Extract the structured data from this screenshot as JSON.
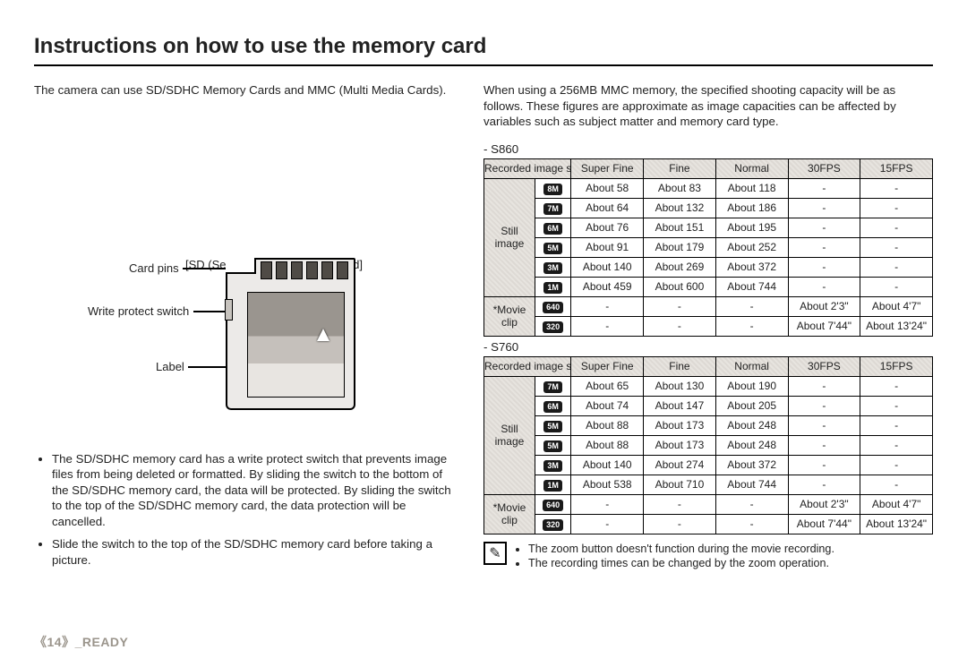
{
  "title": "Instructions on how to use the memory card",
  "left": {
    "intro": "The camera can use SD/SDHC Memory Cards and MMC (Multi Media Cards).",
    "callouts": {
      "pins": "Card pins",
      "wps": "Write protect switch",
      "label": "Label"
    },
    "sdcaption": "[SD (Secure Digital) memory card]",
    "bullets": [
      "The SD/SDHC memory card has a write protect switch that prevents image files from being deleted or formatted. By sliding the switch to the bottom of the SD/SDHC memory card, the data will be protected. By sliding the switch to the top of the SD/SDHC memory card, the data protection will be cancelled.",
      "Slide the switch to the top of the SD/SDHC memory card before taking a picture."
    ]
  },
  "right": {
    "intro": "When using a 256MB MMC memory, the specified shooting capacity will be as follows. These figures are approximate as image capacities can be affected by variables such as subject matter and memory card type.",
    "models": [
      "- S860",
      "- S760"
    ],
    "headers": {
      "ri": "Recorded image size",
      "sf": "Super Fine",
      "f": "Fine",
      "n": "Normal",
      "f30": "30FPS",
      "f15": "15FPS"
    },
    "groups": {
      "still": "Still image",
      "movie": "*Movie clip"
    },
    "tables": [
      {
        "still": [
          {
            "ic": "8M",
            "sf": "About 58",
            "f": "About 83",
            "n": "About 118",
            "a": "-",
            "b": "-"
          },
          {
            "ic": "7M",
            "sf": "About 64",
            "f": "About 132",
            "n": "About 186",
            "a": "-",
            "b": "-"
          },
          {
            "ic": "6M",
            "sf": "About 76",
            "f": "About 151",
            "n": "About 195",
            "a": "-",
            "b": "-"
          },
          {
            "ic": "5M",
            "sf": "About 91",
            "f": "About 179",
            "n": "About 252",
            "a": "-",
            "b": "-"
          },
          {
            "ic": "3M",
            "sf": "About 140",
            "f": "About 269",
            "n": "About 372",
            "a": "-",
            "b": "-"
          },
          {
            "ic": "1M",
            "sf": "About 459",
            "f": "About 600",
            "n": "About 744",
            "a": "-",
            "b": "-"
          }
        ],
        "movie": [
          {
            "ic": "640",
            "sf": "-",
            "f": "-",
            "n": "-",
            "a": "About 2'3\"",
            "b": "About 4'7\""
          },
          {
            "ic": "320",
            "sf": "-",
            "f": "-",
            "n": "-",
            "a": "About 7'44\"",
            "b": "About 13'24\""
          }
        ]
      },
      {
        "still": [
          {
            "ic": "7M",
            "sf": "About 65",
            "f": "About 130",
            "n": "About 190",
            "a": "-",
            "b": "-"
          },
          {
            "ic": "6M",
            "sf": "About 74",
            "f": "About 147",
            "n": "About 205",
            "a": "-",
            "b": "-"
          },
          {
            "ic": "5M",
            "sf": "About 88",
            "f": "About 173",
            "n": "About 248",
            "a": "-",
            "b": "-"
          },
          {
            "ic": "5M",
            "sf": "About 88",
            "f": "About 173",
            "n": "About 248",
            "a": "-",
            "b": "-"
          },
          {
            "ic": "3M",
            "sf": "About 140",
            "f": "About 274",
            "n": "About 372",
            "a": "-",
            "b": "-"
          },
          {
            "ic": "1M",
            "sf": "About 538",
            "f": "About 710",
            "n": "About 744",
            "a": "-",
            "b": "-"
          }
        ],
        "movie": [
          {
            "ic": "640",
            "sf": "-",
            "f": "-",
            "n": "-",
            "a": "About 2'3\"",
            "b": "About 4'7\""
          },
          {
            "ic": "320",
            "sf": "-",
            "f": "-",
            "n": "-",
            "a": "About 7'44\"",
            "b": "About 13'24\""
          }
        ]
      }
    ],
    "notes": [
      "The zoom button doesn't function during the movie recording.",
      "The recording times can be changed by the zoom operation."
    ]
  },
  "footer": {
    "page": "《14》",
    "label": "_READY"
  }
}
